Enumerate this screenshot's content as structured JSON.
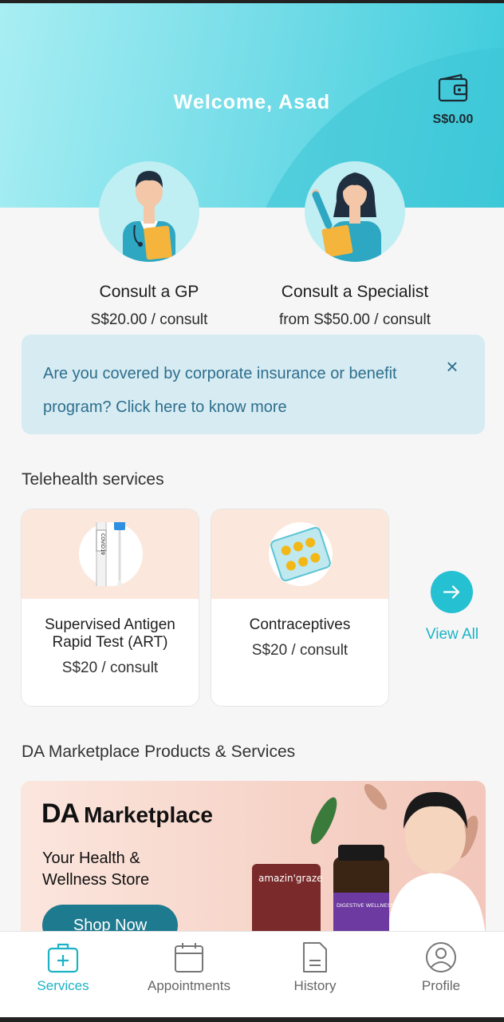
{
  "header": {
    "welcome": "Welcome, Asad",
    "wallet_balance": "S$0.00"
  },
  "consults": [
    {
      "title": "Consult a GP",
      "price": "S$20.00 / consult"
    },
    {
      "title": "Consult a Specialist",
      "price": "from S$50.00 / consult"
    }
  ],
  "banner": {
    "text": "Are you covered by corporate insurance or benefit program? Click here to know more",
    "close": "×"
  },
  "telehealth": {
    "title": "Telehealth services",
    "cards": [
      {
        "title": "Supervised Antigen Rapid Test (ART)",
        "price": "S$20 / consult",
        "image_label": "COVID19"
      },
      {
        "title": "Contraceptives",
        "price": "S$20 / consult"
      }
    ],
    "view_all": "View All"
  },
  "marketplace": {
    "title": "DA Marketplace Products & Services",
    "brand_logo": "DA",
    "brand_name": "Marketplace",
    "tagline": "Your Health & Wellness Store",
    "button": "Shop Now",
    "product_labels": [
      "amazin'graze",
      "DIGESTIVE WELLNESS FORMULA"
    ]
  },
  "nav": {
    "items": [
      {
        "label": "Services",
        "icon": "medical-bag-icon",
        "active": true
      },
      {
        "label": "Appointments",
        "icon": "calendar-icon",
        "active": false
      },
      {
        "label": "History",
        "icon": "document-icon",
        "active": false
      },
      {
        "label": "Profile",
        "icon": "user-icon",
        "active": false
      }
    ]
  },
  "colors": {
    "accent": "#26c0d3",
    "hero_start": "#a8eef3",
    "hero_end": "#3ccbdb",
    "banner_bg": "#d7ebf3",
    "banner_text": "#2d6f8c",
    "card_top": "#fbe7dc",
    "shop_button": "#1e7a8f"
  }
}
